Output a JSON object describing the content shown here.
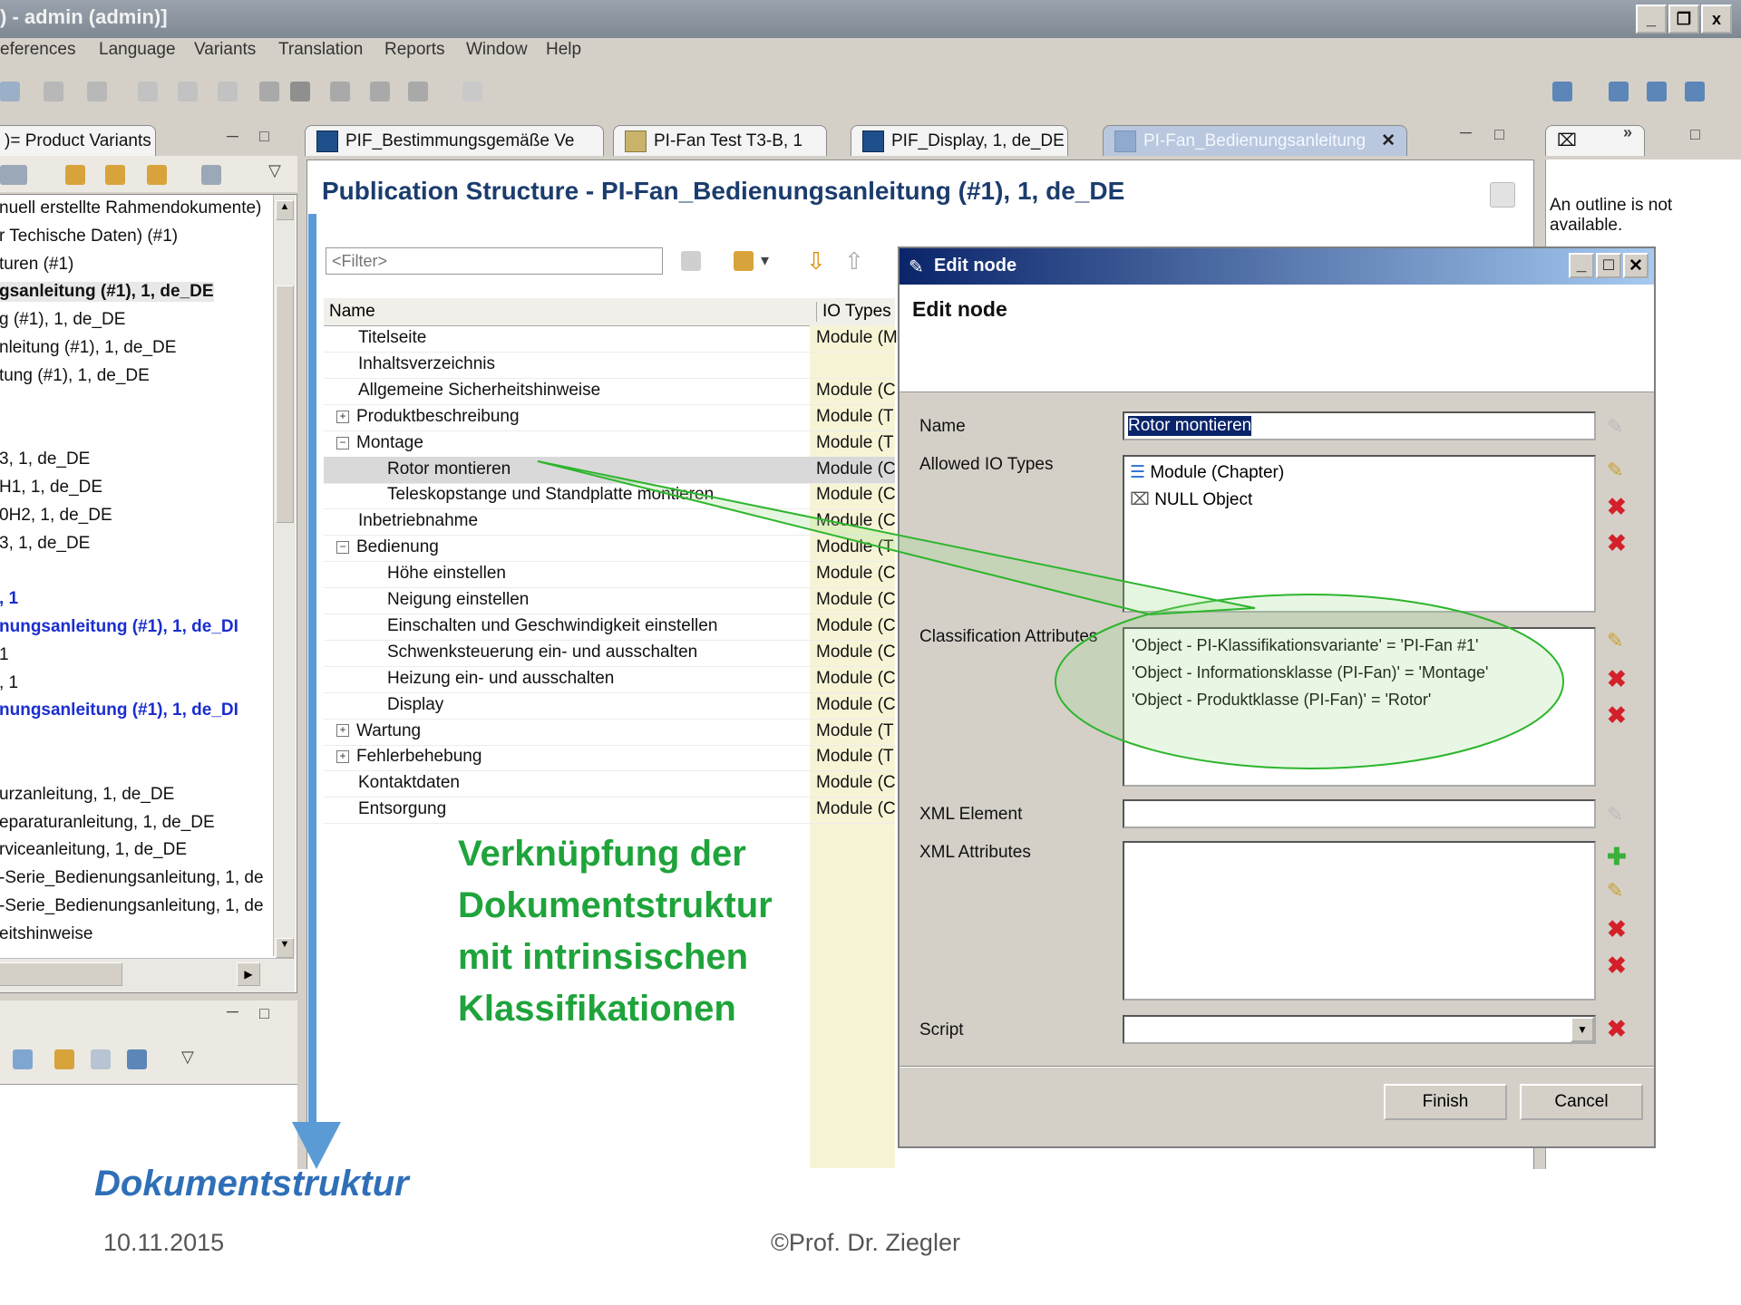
{
  "window": {
    "title": ") - admin (admin)]",
    "controls": [
      "_",
      "❐",
      "x"
    ]
  },
  "menu": [
    "eferences",
    "Language",
    "Variants",
    "Translation",
    "Reports",
    "Window",
    "Help"
  ],
  "left_panel": {
    "tab_label": ")= Product Variants",
    "tree": [
      {
        "text": "nuell erstellte Rahmendokumente)",
        "style": "normal"
      },
      {
        "text": "r Techische Daten) (#1)",
        "style": "normal"
      },
      {
        "text": "turen (#1)",
        "style": "normal"
      },
      {
        "text": "gsanleitung (#1), 1, de_DE",
        "style": "bold"
      },
      {
        "text": "g (#1), 1, de_DE",
        "style": "normal"
      },
      {
        "text": "nleitung (#1), 1, de_DE",
        "style": "normal"
      },
      {
        "text": "tung (#1), 1, de_DE",
        "style": "normal"
      },
      {
        "text": "",
        "style": "normal"
      },
      {
        "text": "",
        "style": "normal"
      },
      {
        "text": "3, 1, de_DE",
        "style": "normal"
      },
      {
        "text": "H1, 1, de_DE",
        "style": "normal"
      },
      {
        "text": "0H2, 1, de_DE",
        "style": "normal"
      },
      {
        "text": "3, 1, de_DE",
        "style": "normal"
      },
      {
        "text": "",
        "style": "normal"
      },
      {
        "text": ", 1",
        "style": "blue"
      },
      {
        "text": "nungsanleitung (#1), 1, de_DI",
        "style": "blue"
      },
      {
        "text": "1",
        "style": "normal"
      },
      {
        "text": ", 1",
        "style": "normal"
      },
      {
        "text": "nungsanleitung (#1), 1, de_DI",
        "style": "blue"
      },
      {
        "text": "",
        "style": "normal"
      },
      {
        "text": "",
        "style": "normal"
      },
      {
        "text": "urzanleitung, 1, de_DE",
        "style": "normal"
      },
      {
        "text": "eparaturanleitung, 1, de_DE",
        "style": "normal"
      },
      {
        "text": "rviceanleitung, 1, de_DE",
        "style": "normal"
      },
      {
        "text": "-Serie_Bedienungsanleitung, 1, de",
        "style": "normal"
      },
      {
        "text": "-Serie_Bedienungsanleitung, 1, de",
        "style": "normal"
      },
      {
        "text": "eitshinweise",
        "style": "normal"
      }
    ]
  },
  "editor_tabs": [
    {
      "label": "PIF_Bestimmungsgemäße Ve",
      "active": false
    },
    {
      "label": "PI-Fan Test T3-B, 1",
      "active": false
    },
    {
      "label": "PIF_Display, 1, de_DE",
      "active": false
    },
    {
      "label": "PI-Fan_Bedienungsanleitung",
      "active": true
    }
  ],
  "editor": {
    "title": "Publication Structure - PI-Fan_Bedienungsanleitung (#1), 1, de_DE",
    "filter_placeholder": "<Filter>",
    "columns": [
      "Name",
      "IO Types"
    ],
    "rows": [
      {
        "name": "Titelseite",
        "io": "Module (M",
        "indent": 1,
        "exp": ""
      },
      {
        "name": "Inhaltsverzeichnis",
        "io": "",
        "indent": 1,
        "exp": ""
      },
      {
        "name": "Allgemeine Sicherheitshinweise",
        "io": "Module (C",
        "indent": 1,
        "exp": ""
      },
      {
        "name": "Produktbeschreibung",
        "io": "Module (T",
        "indent": 1,
        "exp": "+"
      },
      {
        "name": "Montage",
        "io": "Module (T",
        "indent": 1,
        "exp": "−"
      },
      {
        "name": "Rotor montieren",
        "io": "Module (C",
        "indent": 2,
        "exp": "",
        "selected": true
      },
      {
        "name": "Teleskopstange und Standplatte montieren",
        "io": "Module (C",
        "indent": 2,
        "exp": ""
      },
      {
        "name": "Inbetriebnahme",
        "io": "Module (C",
        "indent": 1,
        "exp": ""
      },
      {
        "name": "Bedienung",
        "io": "Module (T",
        "indent": 1,
        "exp": "−"
      },
      {
        "name": "Höhe einstellen",
        "io": "Module (C",
        "indent": 2,
        "exp": ""
      },
      {
        "name": "Neigung einstellen",
        "io": "Module (C",
        "indent": 2,
        "exp": ""
      },
      {
        "name": "Einschalten und Geschwindigkeit einstellen",
        "io": "Module (C",
        "indent": 2,
        "exp": ""
      },
      {
        "name": "Schwenksteuerung ein- und ausschalten",
        "io": "Module (C",
        "indent": 2,
        "exp": ""
      },
      {
        "name": "Heizung ein- und ausschalten",
        "io": "Module (C",
        "indent": 2,
        "exp": ""
      },
      {
        "name": "Display",
        "io": "Module (C",
        "indent": 2,
        "exp": ""
      },
      {
        "name": "Wartung",
        "io": "Module (T",
        "indent": 1,
        "exp": "+"
      },
      {
        "name": "Fehlerbehebung",
        "io": "Module (T",
        "indent": 1,
        "exp": "+"
      },
      {
        "name": "Kontaktdaten",
        "io": "Module (C",
        "indent": 1,
        "exp": ""
      },
      {
        "name": "Entsorgung",
        "io": "Module (C",
        "indent": 1,
        "exp": ""
      }
    ]
  },
  "dialog": {
    "titlebar": "Edit node",
    "heading": "Edit node",
    "labels": {
      "name": "Name",
      "allowed_io": "Allowed IO Types",
      "classification": "Classification Attributes",
      "xml_element": "XML Element",
      "xml_attributes": "XML Attributes",
      "script": "Script"
    },
    "name_value": "Rotor montieren",
    "io_types": [
      "Module (Chapter)",
      "NULL Object"
    ],
    "classification_attributes": [
      "'Object - PI-Klassifikationsvariante' = 'PI-Fan #1'",
      "'Object - Informationsklasse (PI-Fan)' = 'Montage'",
      "'Object - Produktklasse (PI-Fan)' = 'Rotor'"
    ],
    "xml_element_value": "",
    "script_value": "",
    "finish": "Finish",
    "cancel": "Cancel"
  },
  "outline": {
    "message": "An outline is not available."
  },
  "annotation": {
    "lines": [
      "Verknüpfung der",
      "Dokumentstruktur",
      "mit intrinsischen",
      "Klassifikationen"
    ],
    "arrow_label": "Dokumentstruktur"
  },
  "footer": {
    "date": "10.11.2015",
    "author": "©Prof. Dr. Ziegler"
  },
  "colors": {
    "annotation_green": "#1fa33b",
    "arrow_blue": "#5b9bd5",
    "dialog_title": "#0a246a",
    "tree_blue": "#1a2ecf"
  }
}
